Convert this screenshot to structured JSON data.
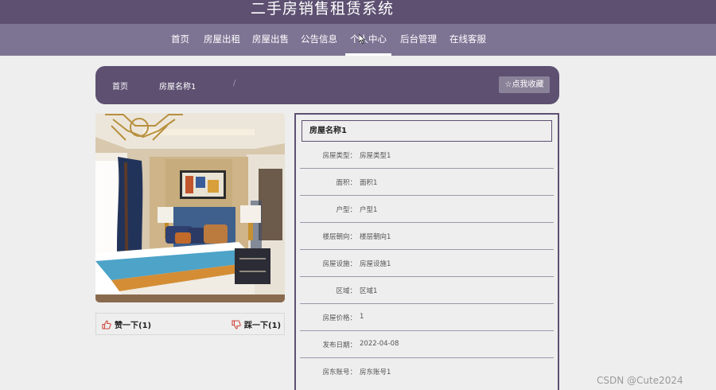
{
  "site": {
    "title": "二手房销售租赁系统"
  },
  "nav": {
    "items": [
      {
        "label": "首页"
      },
      {
        "label": "房屋出租"
      },
      {
        "label": "房屋出售"
      },
      {
        "label": "公告信息"
      },
      {
        "label": "个人中心",
        "active": true
      },
      {
        "label": "后台管理"
      },
      {
        "label": "在线客服"
      }
    ]
  },
  "breadcrumb": {
    "home": "首页",
    "separator": "/",
    "current": "房屋名称1",
    "favorite_label": "☆点我收藏"
  },
  "votes": {
    "like_label": "赞一下(1)",
    "dislike_label": "踩一下(1)"
  },
  "details": {
    "title": "房屋名称1",
    "rows": [
      {
        "label": "房屋类型：",
        "value": "房屋类型1"
      },
      {
        "label": "面积：",
        "value": "面积1"
      },
      {
        "label": "户型：",
        "value": "户型1"
      },
      {
        "label": "楼层朝向：",
        "value": "楼层朝向1"
      },
      {
        "label": "房屋设施：",
        "value": "房屋设施1"
      },
      {
        "label": "区域：",
        "value": "区域1"
      },
      {
        "label": "房屋价格：",
        "value": "1"
      },
      {
        "label": "发布日期：",
        "value": "2022-04-08"
      },
      {
        "label": "房东账号：",
        "value": "房东账号1"
      }
    ]
  },
  "watermark": "CSDN @Cute2024",
  "colors": {
    "primary": "#5d5071",
    "nav": "#7d7494",
    "background": "#eeeeee"
  }
}
